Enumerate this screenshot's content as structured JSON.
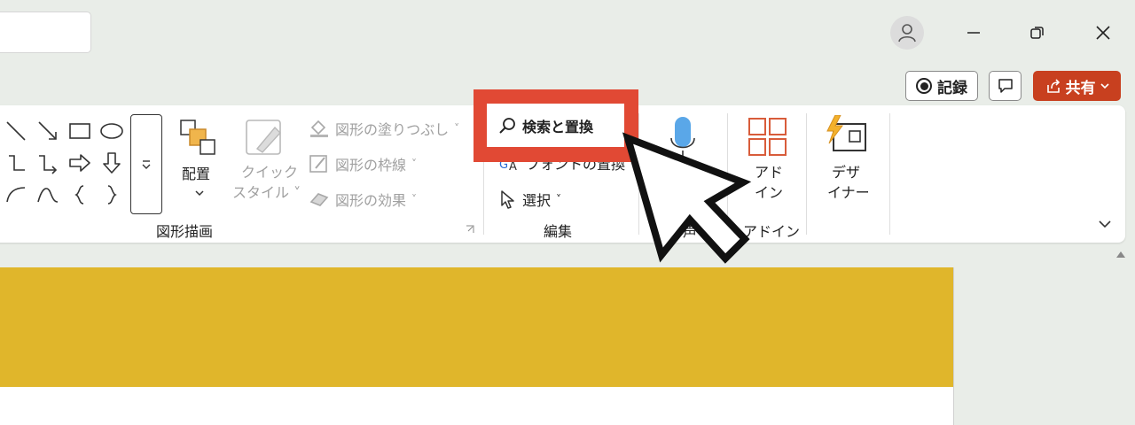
{
  "ribbon": {
    "drawing": {
      "group_label": "図形描画",
      "arrange_label": "配置",
      "quick_style_line1": "クイック",
      "quick_style_line2": "スタイル",
      "shape_fill_label": "図形の塗りつぶし",
      "shape_outline_label": "図形の枠線",
      "shape_effects_label": "図形の効果"
    },
    "editing": {
      "group_label": "編集",
      "find_replace_label": "検索と置換",
      "replace_fonts_label": "フォントの置換",
      "select_label": "選択"
    },
    "voice": {
      "group_label_fragment": "声"
    },
    "addins": {
      "button_line1": "アド",
      "button_line2": "イン",
      "group_label": "アドイン"
    },
    "designer": {
      "button_line1": "デザ",
      "button_line2": "イナー"
    }
  },
  "titlebar": {
    "record_label": "記録",
    "share_label": "共有"
  },
  "colors": {
    "share_bg": "#c8401f",
    "highlight": "#e14934",
    "slide_band": "#e0b62b",
    "addins_icon": "#d85c3a",
    "mic": "#5aa7e8"
  }
}
